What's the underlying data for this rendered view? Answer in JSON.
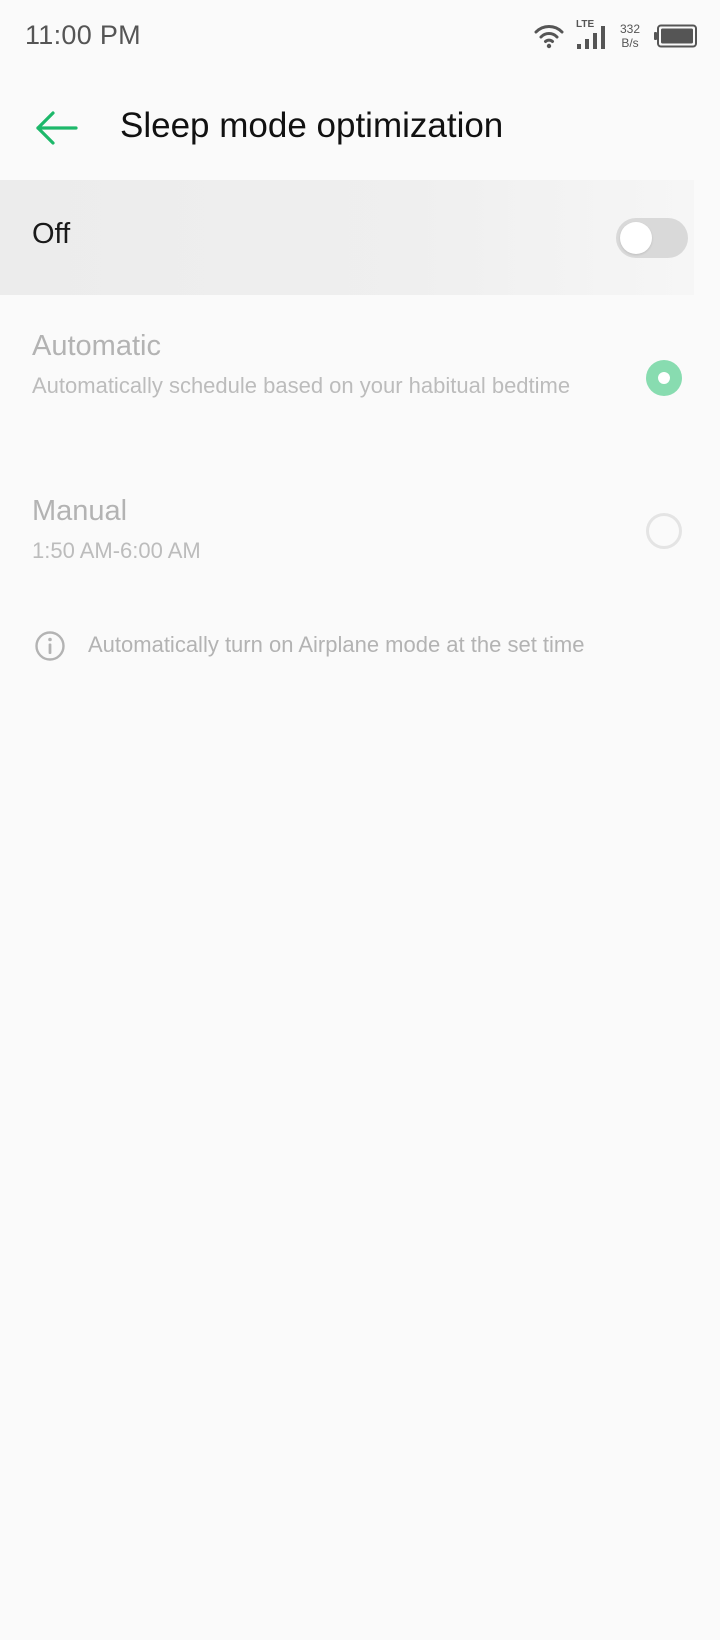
{
  "status_bar": {
    "time": "11:00 PM",
    "network_type": "LTE",
    "net_speed_value": "332",
    "net_speed_unit": "B/s",
    "icons": [
      "wifi-icon",
      "signal-icon",
      "battery-icon"
    ]
  },
  "app_bar": {
    "back_icon": "arrow-left-icon",
    "title": "Sleep mode optimization"
  },
  "master_switch": {
    "label": "Off",
    "state": "off"
  },
  "options": [
    {
      "title": "Automatic",
      "description": "Automatically schedule based on your habitual bedtime",
      "selected": true
    },
    {
      "title": "Manual",
      "description": "1:50 AM-6:00 AM",
      "selected": false
    }
  ],
  "info": {
    "icon": "info-icon",
    "text": "Automatically turn on Airplane mode at the set time"
  },
  "colors": {
    "accent": "#1db86a",
    "radio_selected_disabled": "#88dcb0",
    "disabled_text": "#b3b3b3",
    "background": "#fafafa"
  }
}
